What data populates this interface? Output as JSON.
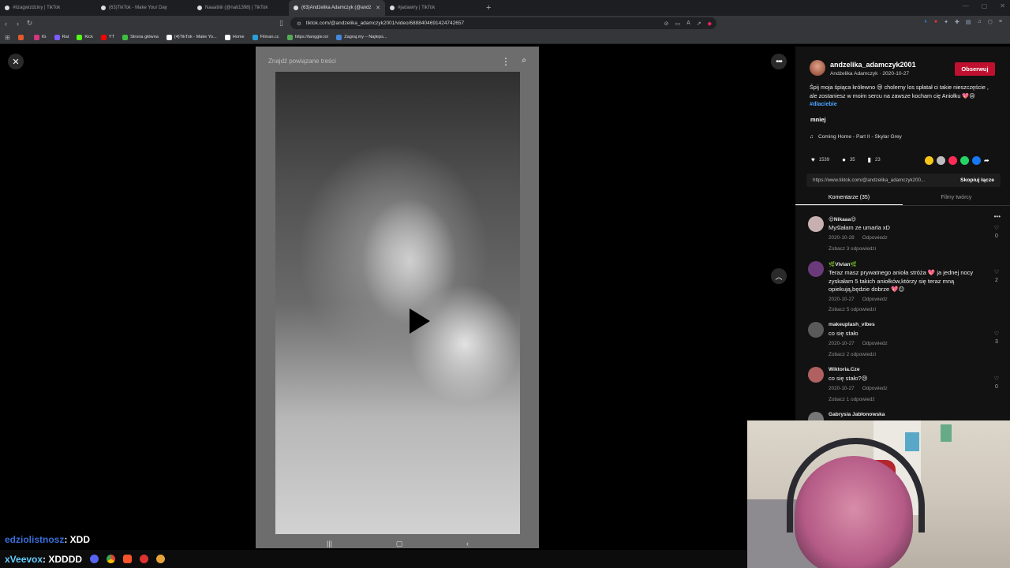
{
  "browser": {
    "tabs": [
      {
        "title": "#lizagwizdziny | TikTok",
        "active": false
      },
      {
        "title": "(63)TikTok - Make Your Day",
        "active": false
      },
      {
        "title": "Naaatiiiii (@nati1398) | TikTok",
        "active": false
      },
      {
        "title": "(63)Andżelika Adamczyk (@andż",
        "active": true
      },
      {
        "title": "#jadawiry | TikTok",
        "active": false
      }
    ],
    "new_tab_symbol": "+",
    "url": "tiktok.com/@andzelika_adamczyk2001/video/6888404691424742657",
    "bookmarks": [
      {
        "label": "",
        "color": "#e05a2b"
      },
      {
        "label": "IG",
        "color": "#d3367d"
      },
      {
        "label": "Rat",
        "color": "#7a5cff"
      },
      {
        "label": "Kick",
        "color": "#53fc18"
      },
      {
        "label": "YT",
        "color": "#ff0000"
      },
      {
        "label": "Strona główna",
        "color": "#3fbf3f"
      },
      {
        "label": "(4)TikTok - Make Yo...",
        "color": "#ffffff"
      },
      {
        "label": "Home",
        "color": "#ffffff"
      },
      {
        "label": "Filman.cc",
        "color": "#2aa0d8"
      },
      {
        "label": "https://tanggle.io/",
        "color": "#55aa55"
      },
      {
        "label": "Zagraj.my – Najleps...",
        "color": "#4488dd"
      }
    ]
  },
  "video": {
    "search_label": "Znajdź powiązane treści",
    "icons": {
      "close": "close-icon",
      "more": "more-horizontal-icon",
      "up": "chevron-up-icon",
      "play": "play-icon",
      "search": "search-icon"
    }
  },
  "panel": {
    "username": "andzelika_adamczyk2001",
    "display_name": "Andżelika Adamczyk",
    "date": "2020-10-27",
    "subline": "Andżelika Adamczyk · 2020-10-27",
    "follow_label": "Obserwuj",
    "description": "Śpij moja śpiąca królewno 😢 cholerny los spłatał ci takie nieszczęście , ale zostaniesz w moim sercu na zawsze kocham cię Aniołku 💖😢",
    "hashtag": "#dlaciebie",
    "more_label": "mniej",
    "music": "Coming Home - Part II - Skylar Grey",
    "stats": {
      "likes": "1539",
      "comments": "35",
      "saves": "23"
    },
    "share_colors": [
      "#f5c518",
      "#bdbdbd",
      "#fe2c55",
      "#25d366",
      "#1877f2"
    ],
    "link": "https://www.tiktok.com/@andzelika_adamczyk200...",
    "copy_label": "Skopiuj łącze",
    "tabs": [
      {
        "label": "Komentarze (35)",
        "active": true
      },
      {
        "label": "Filmy twórcy",
        "active": false
      }
    ],
    "comments": [
      {
        "user": "😍Nikaaa😍",
        "text": "Myślałam ze umarla xD",
        "date": "2020-10-28",
        "reply": "Odpowiedz",
        "replies": "Zobacz 3 odpowiedzi",
        "likes": "0",
        "avatar": "#c8b0b0"
      },
      {
        "user": "🌿Vivian🌿",
        "text": "Teraz masz prywatnego anioła stróża 💖 ja jednej nocy zyskałam 5 takich aniołków,którzy się teraz mną opiekują,będzie dobrze 💖😊",
        "date": "2020-10-27",
        "reply": "Odpowiedz",
        "replies": "Zobacz 5 odpowiedzi",
        "likes": "2",
        "avatar": "#6a3a7a"
      },
      {
        "user": "makeuplash_vibes",
        "text": "co się stało",
        "date": "2020-10-27",
        "reply": "Odpowiedz",
        "replies": "Zobacz 2 odpowiedzi",
        "likes": "3",
        "avatar": "#5a5a5a"
      },
      {
        "user": "Wiktoria.Cze",
        "text": "co się stało?😢",
        "date": "2020-10-27",
        "reply": "Odpowiedz",
        "replies": "Zobacz 1 odpowiedź",
        "likes": "0",
        "avatar": "#b06060"
      },
      {
        "user": "Gabrysia Jabłonowska",
        "avatar": "#777777"
      }
    ]
  },
  "overlay": {
    "chat_name": "edziolistnosz",
    "chat_message": ": XDD",
    "taskbar_name": "xVeevox",
    "taskbar_message": ": XDDDD"
  }
}
